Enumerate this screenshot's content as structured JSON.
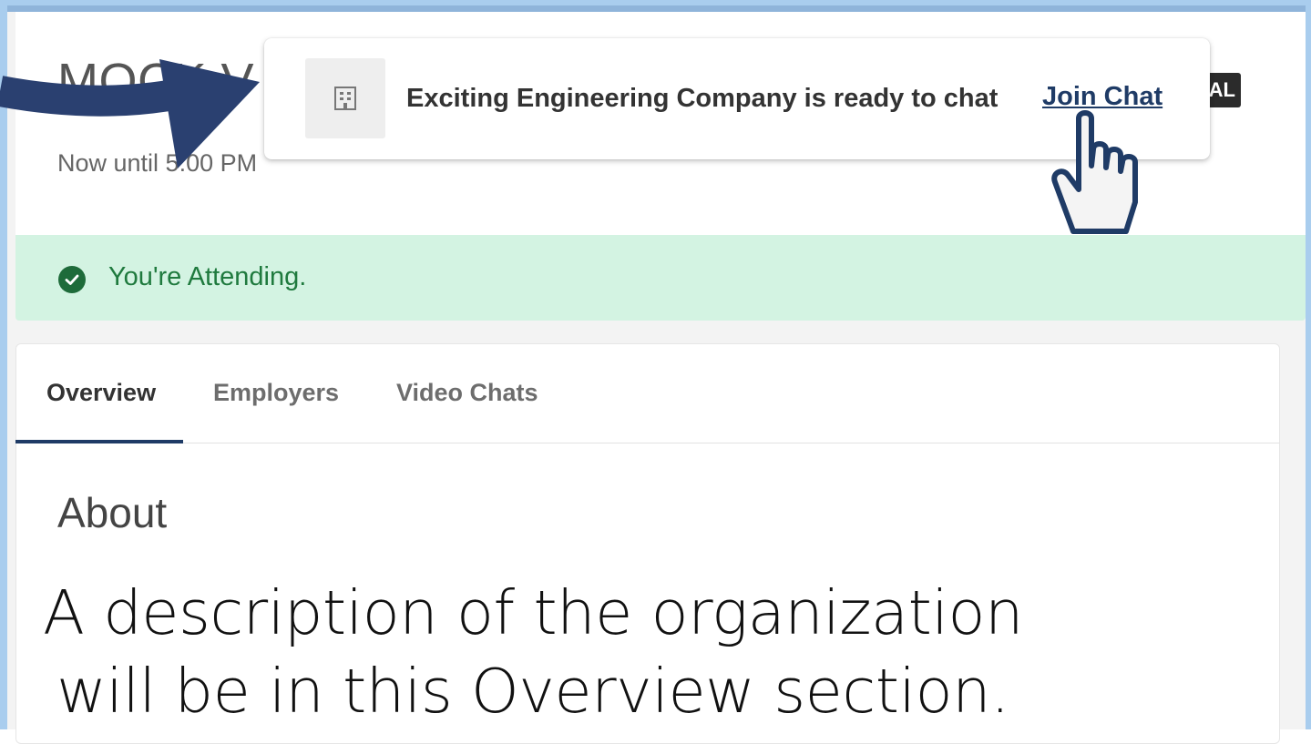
{
  "event": {
    "title": "MOCK V",
    "time": "Now until 5:00 PM",
    "badge": "AL"
  },
  "attendance": {
    "status_text": "You're Attending."
  },
  "tabs": [
    {
      "label": "Overview",
      "active": true
    },
    {
      "label": "Employers",
      "active": false
    },
    {
      "label": "Video Chats",
      "active": false
    }
  ],
  "overview": {
    "heading": "About",
    "description": "A description of the organization will be in this Overview section."
  },
  "notification": {
    "message": "Exciting Engineering Company is ready to chat",
    "action_label": "Join Chat",
    "icon": "building-icon"
  },
  "colors": {
    "accent": "#1f3b66",
    "success": "#1f7a3e",
    "success_bg": "#d3f3e2",
    "frame": "#a9cdee"
  }
}
